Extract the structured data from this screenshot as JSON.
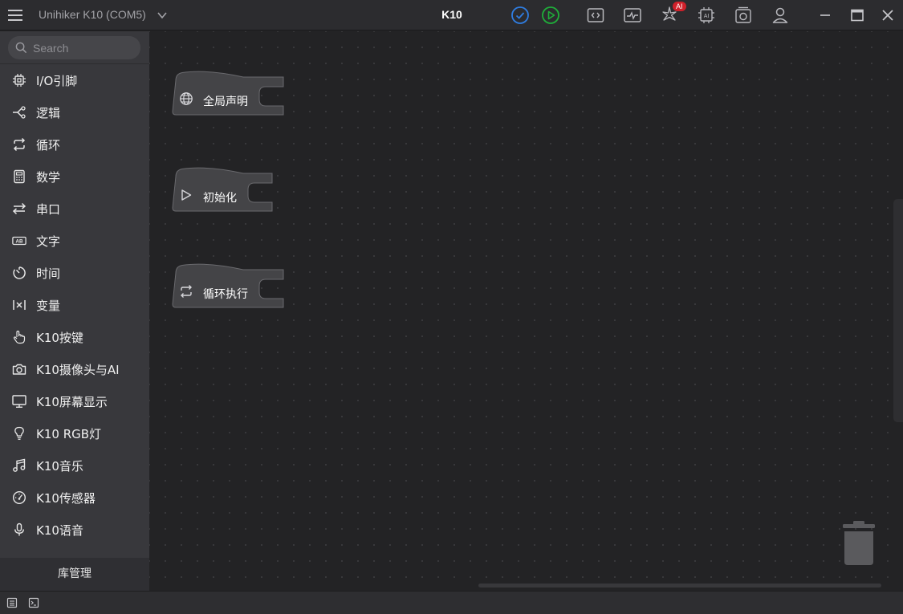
{
  "titlebar": {
    "device": "Unihiker K10 (COM5)",
    "project": "K10",
    "ai_badge": "AI",
    "icons": [
      "menu-icon",
      "chevron-down-icon",
      "check-circle-icon",
      "play-circle-icon",
      "code-icon",
      "serial-monitor-icon",
      "ai-sparkle-icon",
      "ai-chip-icon",
      "camera-box-icon",
      "user-icon",
      "minimize-icon",
      "maximize-icon",
      "close-icon"
    ]
  },
  "sidebar": {
    "search_placeholder": "Search",
    "items": [
      {
        "label": "I/O引脚",
        "icon": "chip-icon"
      },
      {
        "label": "逻辑",
        "icon": "branch-icon"
      },
      {
        "label": "循环",
        "icon": "loop-icon"
      },
      {
        "label": "数学",
        "icon": "calculator-icon"
      },
      {
        "label": "串口",
        "icon": "swap-arrows-icon"
      },
      {
        "label": "文字",
        "icon": "text-ab-icon"
      },
      {
        "label": "时间",
        "icon": "timer-icon"
      },
      {
        "label": "变量",
        "icon": "variable-icon"
      },
      {
        "label": "K10按键",
        "icon": "hand-pointer-icon"
      },
      {
        "label": "K10摄像头与AI",
        "icon": "camera-icon"
      },
      {
        "label": "K10屏幕显示",
        "icon": "monitor-icon"
      },
      {
        "label": "K10 RGB灯",
        "icon": "bulb-icon"
      },
      {
        "label": "K10音乐",
        "icon": "music-icon"
      },
      {
        "label": "K10传感器",
        "icon": "gauge-icon"
      },
      {
        "label": "K10语音",
        "icon": "mic-icon"
      }
    ],
    "library_manager": "库管理"
  },
  "workspace": {
    "blocks": [
      {
        "label": "全局声明",
        "icon": "globe-icon"
      },
      {
        "label": "初始化",
        "icon": "play-triangle-icon"
      },
      {
        "label": "循环执行",
        "icon": "loop-icon"
      }
    ],
    "trash_icon": "trash-icon"
  },
  "statusbar": {
    "icons": [
      "list-icon",
      "terminal-icon"
    ]
  }
}
